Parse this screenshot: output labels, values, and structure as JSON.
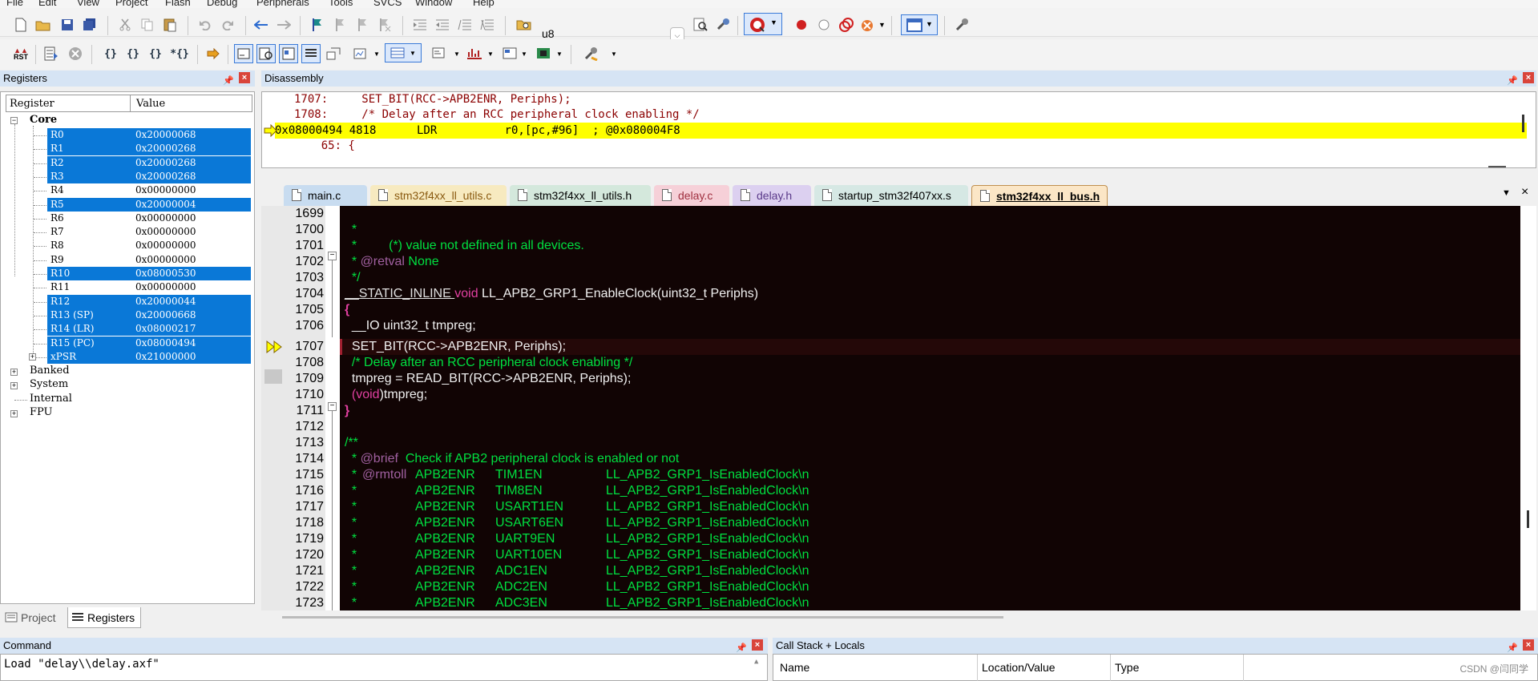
{
  "menu": [
    "File",
    "Edit",
    "View",
    "Project",
    "Flash",
    "Debug",
    "Peripherals",
    "Tools",
    "SVCS",
    "Window",
    "Help"
  ],
  "toolbar": {
    "target_value": "u8"
  },
  "registers_panel": {
    "title": "Registers",
    "col_register": "Register",
    "col_value": "Value",
    "core_label": "Core",
    "rows": [
      {
        "name": "R0",
        "value": "0x20000068",
        "selected": true
      },
      {
        "name": "R1",
        "value": "0x20000268",
        "selected": true
      },
      {
        "name": "R2",
        "value": "0x20000268",
        "selected": true
      },
      {
        "name": "R3",
        "value": "0x20000268",
        "selected": true
      },
      {
        "name": "R4",
        "value": "0x00000000",
        "selected": false
      },
      {
        "name": "R5",
        "value": "0x20000004",
        "selected": true
      },
      {
        "name": "R6",
        "value": "0x00000000",
        "selected": false
      },
      {
        "name": "R7",
        "value": "0x00000000",
        "selected": false
      },
      {
        "name": "R8",
        "value": "0x00000000",
        "selected": false
      },
      {
        "name": "R9",
        "value": "0x00000000",
        "selected": false
      },
      {
        "name": "R10",
        "value": "0x08000530",
        "selected": true
      },
      {
        "name": "R11",
        "value": "0x00000000",
        "selected": false
      },
      {
        "name": "R12",
        "value": "0x20000044",
        "selected": true
      },
      {
        "name": "R13 (SP)",
        "value": "0x20000668",
        "selected": true
      },
      {
        "name": "R14 (LR)",
        "value": "0x08000217",
        "selected": true
      },
      {
        "name": "R15 (PC)",
        "value": "0x08000494",
        "selected": true
      },
      {
        "name": "xPSR",
        "value": "0x21000000",
        "selected": true
      }
    ],
    "groups": [
      "Banked",
      "System",
      "Internal",
      "FPU"
    ],
    "tab_project": "Project",
    "tab_registers": "Registers"
  },
  "disassembly": {
    "title": "Disassembly",
    "line1": "1707:     SET_BIT(RCC->APB2ENR, Periphs);",
    "line2": "1708:     /* Delay after an RCC peripheral clock enabling */",
    "current": "0x08000494 4818      LDR          r0,[pc,#96]  ; @0x080004F8",
    "line4": "    65: {"
  },
  "editor_tabs": [
    {
      "label": "main.c",
      "color": "#c8dcf0",
      "active": false
    },
    {
      "label": "stm32f4xx_ll_utils.c",
      "color": "#f7eac0",
      "active": false
    },
    {
      "label": "stm32f4xx_ll_utils.h",
      "color": "#d4e8dc",
      "active": false
    },
    {
      "label": "delay.c",
      "color": "#f6d0d8",
      "active": false
    },
    {
      "label": "delay.h",
      "color": "#dcd0f0",
      "active": false
    },
    {
      "label": "startup_stm32f407xx.s",
      "color": "#d6e8e4",
      "active": false
    },
    {
      "label": "stm32f4xx_ll_bus.h",
      "color": "#fbe6c6",
      "active": true
    }
  ],
  "code": {
    "line_numbers": [
      "1699",
      "1700",
      "1701",
      "1702",
      "1703",
      "1704",
      "1705",
      "1706",
      "1707",
      "1708",
      "1709",
      "1710",
      "1711",
      "1712",
      "1713",
      "1714",
      "1715",
      "1716",
      "1717",
      "1718",
      "1719",
      "1720",
      "1721",
      "1722",
      "1723"
    ],
    "l1700": "  *",
    "l1701": "  *         (*) value not defined in all devices.",
    "l1702a": "  * ",
    "l1702b": "@retval",
    "l1702c": " None",
    "l1703": "  */",
    "l1704a": "__STATIC_INLINE ",
    "l1704b": "void",
    "l1704c": " LL_APB2_GRP1_EnableClock(uint32_t Periphs)",
    "l1705": "{",
    "l1706": "  __IO uint32_t tmpreg;",
    "l1707": "  SET_BIT(RCC->APB2ENR, Periphs);",
    "l1708": "  /* Delay after an RCC peripheral clock enabling */",
    "l1709": "  tmpreg = READ_BIT(RCC->APB2ENR, Periphs);",
    "l1710a": "  (",
    "l1710b": "void",
    "l1710c": ")tmpreg;",
    "l1711": "}",
    "l1713": "/**",
    "l1714a": "  * ",
    "l1714b": "@brief",
    "l1714c": "  Check if APB2 peripheral clock is enabled or not",
    "rows": [
      {
        "num": "1715",
        "tag": "@rmtoll",
        "reg": "APB2ENR",
        "bit": "TIM1EN",
        "fn": "LL_APB2_GRP1_IsEnabledClock\\n"
      },
      {
        "num": "1716",
        "tag": "",
        "reg": "APB2ENR",
        "bit": "TIM8EN",
        "fn": "LL_APB2_GRP1_IsEnabledClock\\n"
      },
      {
        "num": "1717",
        "tag": "",
        "reg": "APB2ENR",
        "bit": "USART1EN",
        "fn": "LL_APB2_GRP1_IsEnabledClock\\n"
      },
      {
        "num": "1718",
        "tag": "",
        "reg": "APB2ENR",
        "bit": "USART6EN",
        "fn": "LL_APB2_GRP1_IsEnabledClock\\n"
      },
      {
        "num": "1719",
        "tag": "",
        "reg": "APB2ENR",
        "bit": "UART9EN",
        "fn": "LL_APB2_GRP1_IsEnabledClock\\n"
      },
      {
        "num": "1720",
        "tag": "",
        "reg": "APB2ENR",
        "bit": "UART10EN",
        "fn": "LL_APB2_GRP1_IsEnabledClock\\n"
      },
      {
        "num": "1721",
        "tag": "",
        "reg": "APB2ENR",
        "bit": "ADC1EN",
        "fn": "LL_APB2_GRP1_IsEnabledClock\\n"
      },
      {
        "num": "1722",
        "tag": "",
        "reg": "APB2ENR",
        "bit": "ADC2EN",
        "fn": "LL_APB2_GRP1_IsEnabledClock\\n"
      },
      {
        "num": "1723",
        "tag": "",
        "reg": "APB2ENR",
        "bit": "ADC3EN",
        "fn": "LL_APB2_GRP1_IsEnabledClock\\n"
      }
    ]
  },
  "command_panel": {
    "title": "Command",
    "text": "Load \"delay\\\\delay.axf\""
  },
  "callstack_panel": {
    "title": "Call Stack + Locals",
    "col_name": "Name",
    "col_location": "Location/Value",
    "col_type": "Type"
  },
  "watermark": "CSDN @闫同学"
}
